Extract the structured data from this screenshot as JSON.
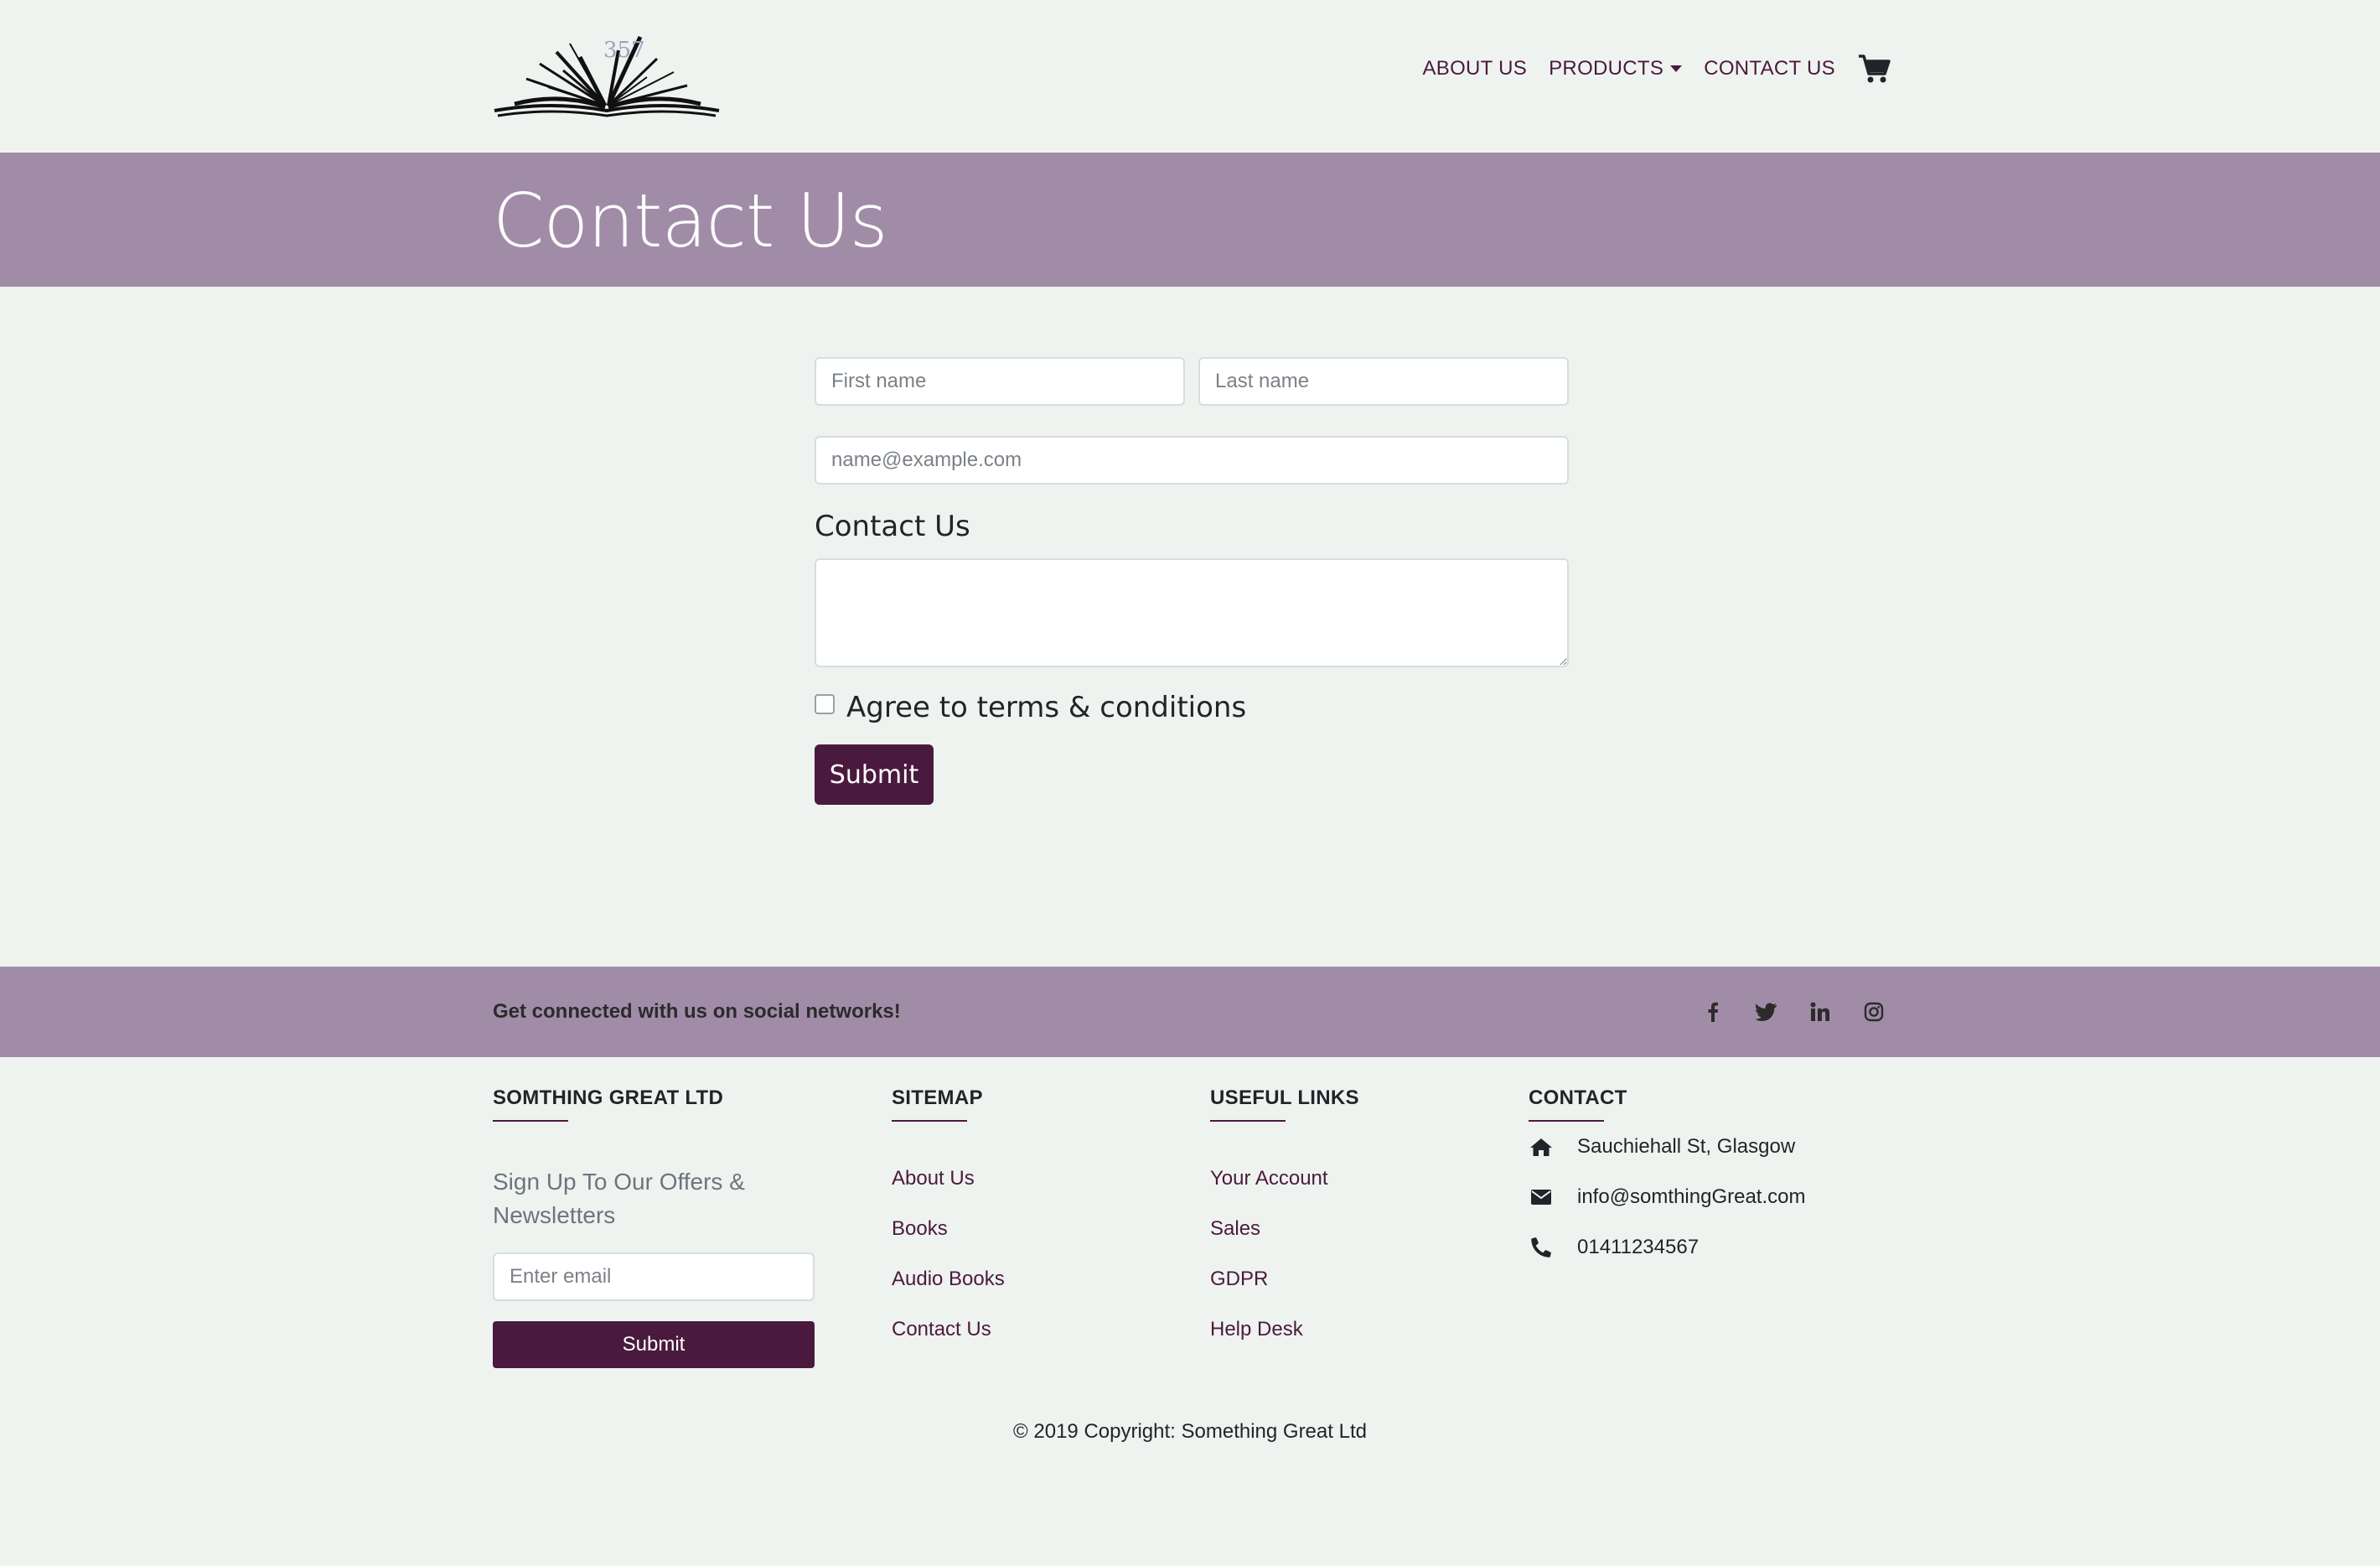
{
  "nav": {
    "logo_number": "357",
    "about": "ABOUT US",
    "products": "PRODUCTS",
    "contact": "CONTACT US"
  },
  "hero": {
    "title": "Contact Us"
  },
  "form": {
    "first_name_placeholder": "First name",
    "last_name_placeholder": "Last name",
    "email_placeholder": "name@example.com",
    "message_label": "Contact Us",
    "message_value": "",
    "agree_label": "Agree to terms & conditions",
    "agree_checked": false,
    "submit_label": "Submit"
  },
  "social": {
    "text": "Get connected with us on social networks!",
    "icons": [
      "facebook-icon",
      "twitter-icon",
      "linkedin-icon",
      "instagram-icon"
    ]
  },
  "footer": {
    "company": {
      "heading": "SOMTHING GREAT LTD",
      "signup_text": "Sign Up To Our Offers & Newsletters",
      "email_placeholder": "Enter email",
      "submit_label": "Submit"
    },
    "sitemap": {
      "heading": "SITEMAP",
      "items": [
        "About Us",
        "Books",
        "Audio Books",
        "Contact Us"
      ]
    },
    "useful": {
      "heading": "USEFUL LINKS",
      "items": [
        "Your Account",
        "Sales",
        "GDPR",
        "Help Desk"
      ]
    },
    "contact": {
      "heading": "CONTACT",
      "address": "Sauchiehall St, Glasgow",
      "email": "info@somthingGreat.com",
      "phone": "01411234567"
    },
    "copyright": "© 2019 Copyright: Something Great Ltd"
  },
  "colors": {
    "background": "#eff3f0",
    "band": "#a18ca8",
    "accent": "#4a1a3e"
  }
}
